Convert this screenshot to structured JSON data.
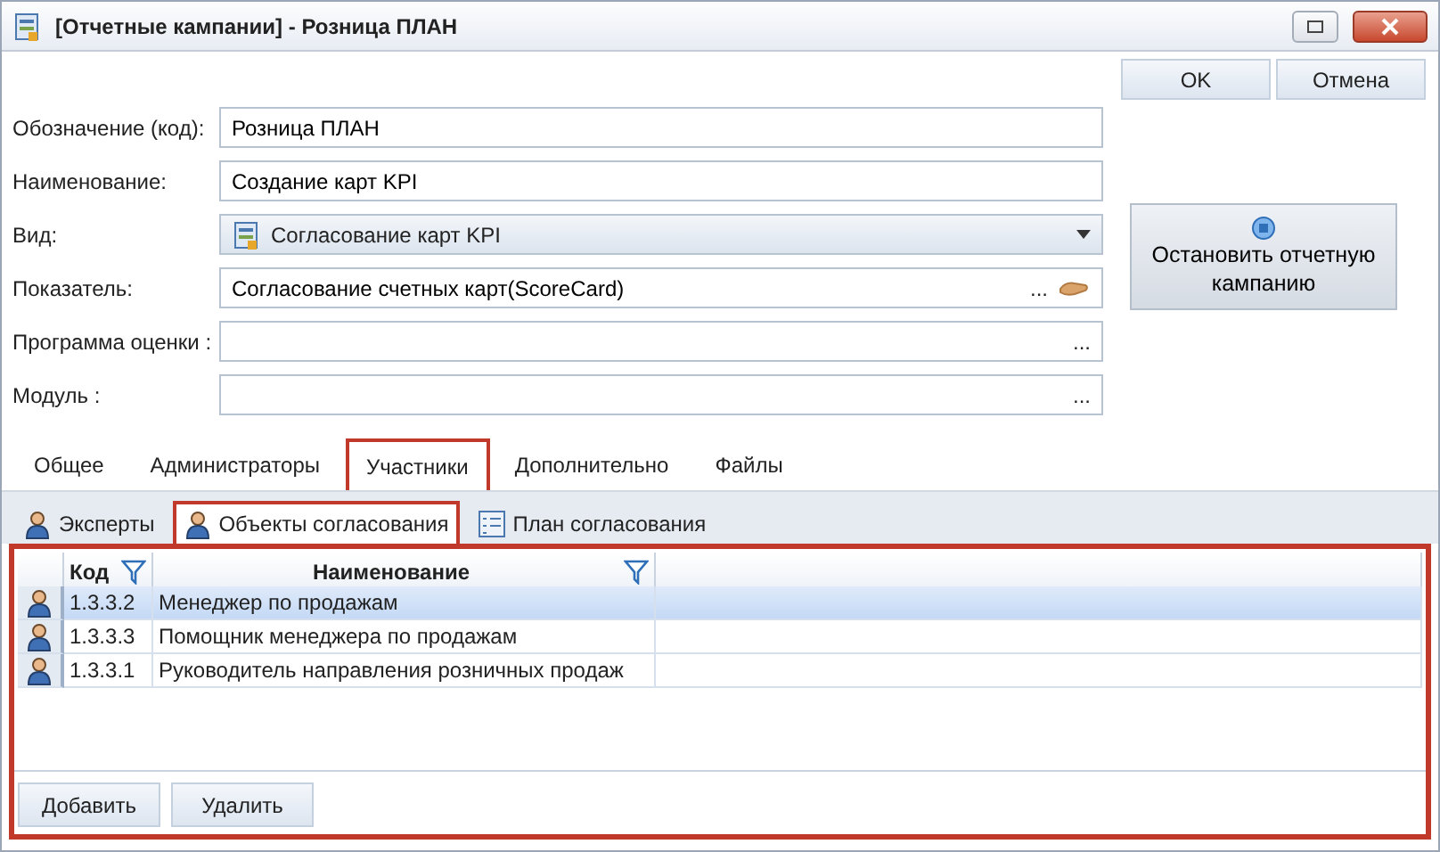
{
  "window": {
    "title": "[Отчетные кампании] - Розница ПЛАН"
  },
  "dialog_buttons": [
    "OK",
    "Отмена"
  ],
  "fields": [
    {
      "label": "Обозначение (код):",
      "kind": "text",
      "value": "Розница ПЛАН"
    },
    {
      "label": "Наименование:",
      "kind": "text",
      "value": "Создание карт KPI"
    },
    {
      "label": "Вид:",
      "kind": "combo",
      "value": "Согласование карт KPI"
    },
    {
      "label": "Показатель:",
      "kind": "lookup",
      "value": "Согласование счетных карт(ScoreCard)",
      "ellipsis": "...",
      "extra_icon": true
    },
    {
      "label": "Программа оценки :",
      "kind": "lookup",
      "ellipsis": "...",
      "extra_icon": false
    },
    {
      "label": "Модуль :",
      "kind": "lookup",
      "ellipsis": "...",
      "extra_icon": false
    }
  ],
  "stop_button": {
    "label": "Остановить отчетную кампанию"
  },
  "tabs": [
    {
      "label": "Общее",
      "selected": false
    },
    {
      "label": "Администраторы",
      "selected": false
    },
    {
      "label": "Участники",
      "selected": true
    },
    {
      "label": "Дополнительно",
      "selected": false
    },
    {
      "label": "Файлы",
      "selected": false
    }
  ],
  "subtabs": [
    {
      "label": "Эксперты",
      "kind": "person",
      "selected": false
    },
    {
      "label": "Объекты согласования",
      "kind": "person",
      "selected": true
    },
    {
      "label": "План согласования",
      "kind": "plan",
      "selected": false
    }
  ],
  "table": {
    "columns": [
      "Код",
      "Наименование"
    ],
    "rows": [
      {
        "code": "1.3.3.2",
        "name": "Менеджер по продажам",
        "selected": true
      },
      {
        "code": "1.3.3.3",
        "name": "Помощник менеджера по продажам",
        "selected": false
      },
      {
        "code": "1.3.3.1",
        "name": "Руководитель направления розничных продаж",
        "selected": false
      }
    ]
  },
  "panel_buttons": [
    "Добавить",
    "Удалить"
  ]
}
